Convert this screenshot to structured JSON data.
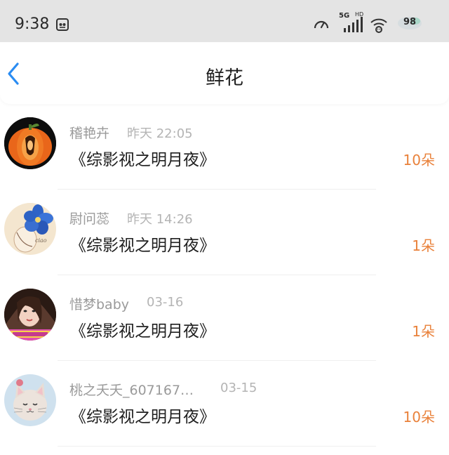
{
  "status_bar": {
    "time": "9:38",
    "network_label": "5G",
    "hd_label": "HD",
    "battery": "98"
  },
  "nav": {
    "title": "鲜花",
    "back_icon": "chevron-left-icon",
    "accent_color": "#2a8cf2"
  },
  "gifts": [
    {
      "sender": "稽艳卉",
      "time": "昨天 22:05",
      "book": "《综影视之明月夜》",
      "count": "10朵",
      "avatar_icon": "pumpkin-avatar"
    },
    {
      "sender": "尉问蕊",
      "time": "昨天 14:26",
      "book": "《综影视之明月夜》",
      "count": "1朵",
      "avatar_icon": "blue-flower-avatar"
    },
    {
      "sender": "惜梦baby",
      "time": "03-16",
      "book": "《综影视之明月夜》",
      "count": "1朵",
      "avatar_icon": "portrait-avatar"
    },
    {
      "sender": "桃之夭夭_607167…",
      "time": "03-15",
      "book": "《综影视之明月夜》",
      "count": "10朵",
      "avatar_icon": "kitten-avatar"
    }
  ],
  "colors": {
    "count_color": "#e9813a",
    "name_color": "#9a9a9a",
    "status_bar_bg": "#e4e4e4"
  }
}
